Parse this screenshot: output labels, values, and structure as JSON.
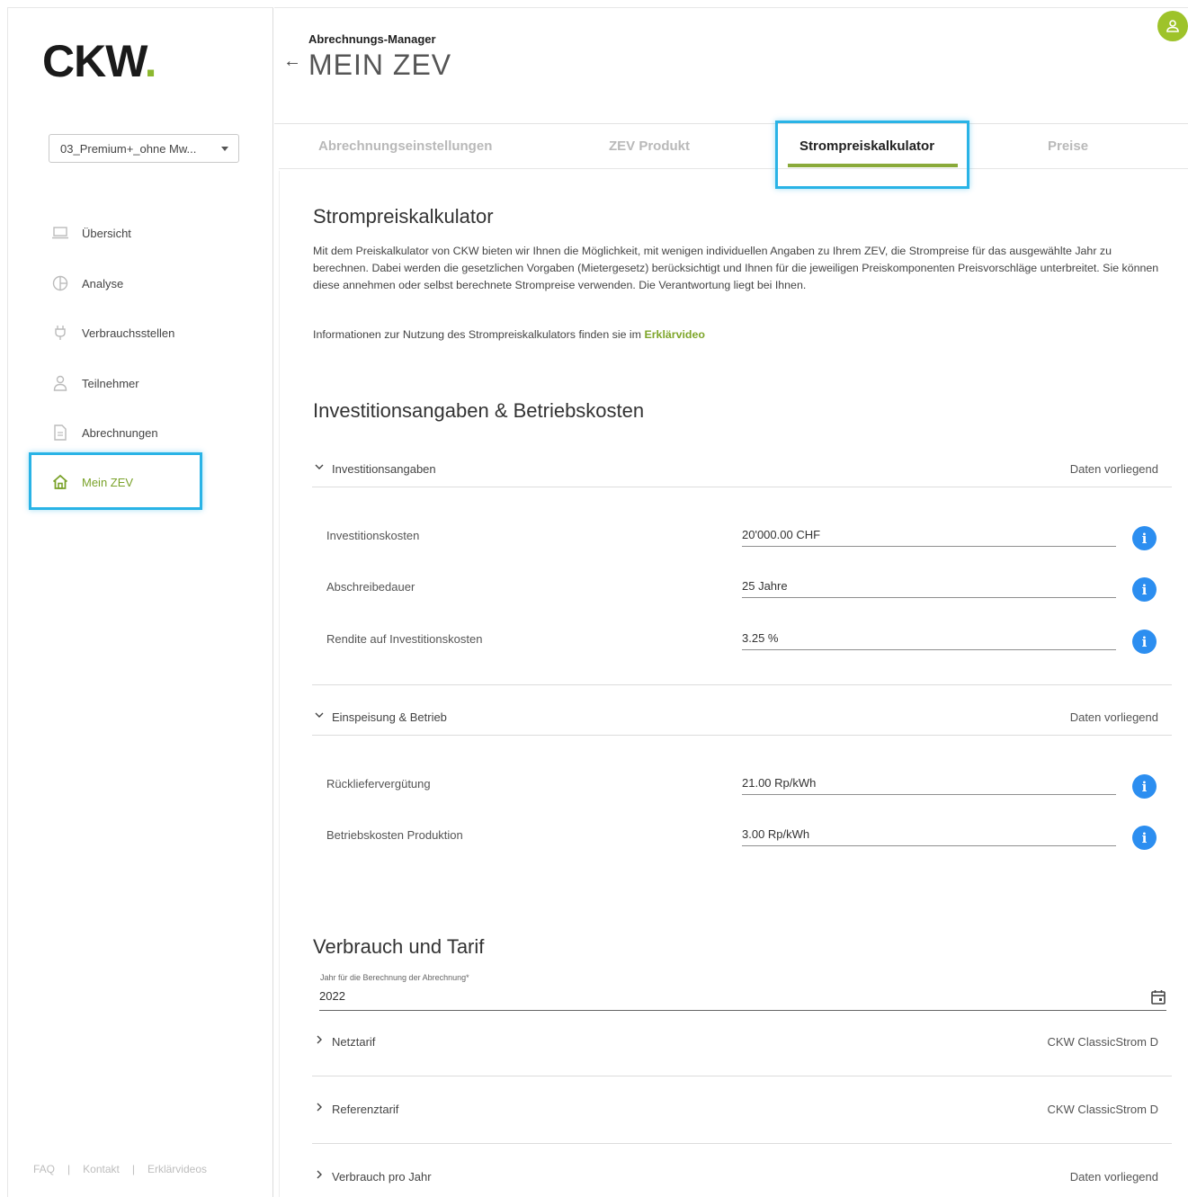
{
  "brand": {
    "logo_text": "CKW",
    "logo_dot": ".",
    "accent": "#8cb82f"
  },
  "sidebar": {
    "project_select": "03_Premium+_ohne Mw...",
    "items": [
      {
        "label": "Übersicht",
        "icon": "laptop-icon"
      },
      {
        "label": "Analyse",
        "icon": "pie-chart-icon"
      },
      {
        "label": "Verbrauchsstellen",
        "icon": "plug-icon"
      },
      {
        "label": "Teilnehmer",
        "icon": "person-icon"
      },
      {
        "label": "Abrechnungen",
        "icon": "document-icon"
      },
      {
        "label": "Mein ZEV",
        "icon": "home-icon",
        "active": true
      }
    ],
    "footer": [
      "FAQ",
      "Kontakt",
      "Erklärvideos"
    ],
    "footer_sep": "|"
  },
  "header": {
    "subtitle": "Abrechnungs-Manager",
    "title": "MEIN ZEV",
    "back": "←"
  },
  "tabs": [
    "Abrechnungseinstellungen",
    "ZEV Produkt",
    "Strompreiskalkulator",
    "Preise"
  ],
  "active_tab": "Strompreiskalkulator",
  "intro": {
    "title": "Strompreiskalkulator",
    "text": "Mit dem Preiskalkulator von CKW bieten wir Ihnen die Möglichkeit, mit wenigen individuellen Angaben zu Ihrem ZEV, die Strompreise für das ausgewählte Jahr zu berechnen. Dabei werden die gesetzlichen Vorgaben (Mietergesetz) berücksichtigt und Ihnen für die jeweiligen Preiskomponenten Preisvorschläge unterbreitet. Sie können diese annehmen oder selbst berechnete Strompreise verwenden. Die Verantwortung liegt bei Ihnen.",
    "info_text": "Informationen zur Nutzung des Strompreiskalkulators finden sie im",
    "link": "Erklärvideo"
  },
  "investment": {
    "title": "Investitionsangaben & Betriebskosten",
    "section1": {
      "label": "Investitionsangaben",
      "status": "Daten vorliegend"
    },
    "fields1": [
      {
        "label": "Investitionskosten",
        "value": "20'000.00 CHF"
      },
      {
        "label": "Abschreibedauer",
        "value": "25  Jahre"
      },
      {
        "label": "Rendite auf Investitionskosten",
        "value": "3.25 %"
      }
    ],
    "section2": {
      "label": "Einspeisung & Betrieb",
      "status": "Daten vorliegend"
    },
    "fields2": [
      {
        "label": "Rückliefervergütung",
        "value": "21.00 Rp/kWh"
      },
      {
        "label": "Betriebskosten Produktion",
        "value": "3.00 Rp/kWh"
      }
    ]
  },
  "consumption": {
    "title": "Verbrauch und Tarif",
    "year_label": "Jahr für die Berechnung der Abrechnung*",
    "year_value": "2022",
    "rows": [
      {
        "label": "Netztarif",
        "value": "CKW ClassicStrom D"
      },
      {
        "label": "Referenztarif",
        "value": "CKW ClassicStrom D"
      },
      {
        "label": "Verbrauch pro Jahr",
        "value": "Daten vorliegend"
      }
    ]
  },
  "info_icon": "i"
}
